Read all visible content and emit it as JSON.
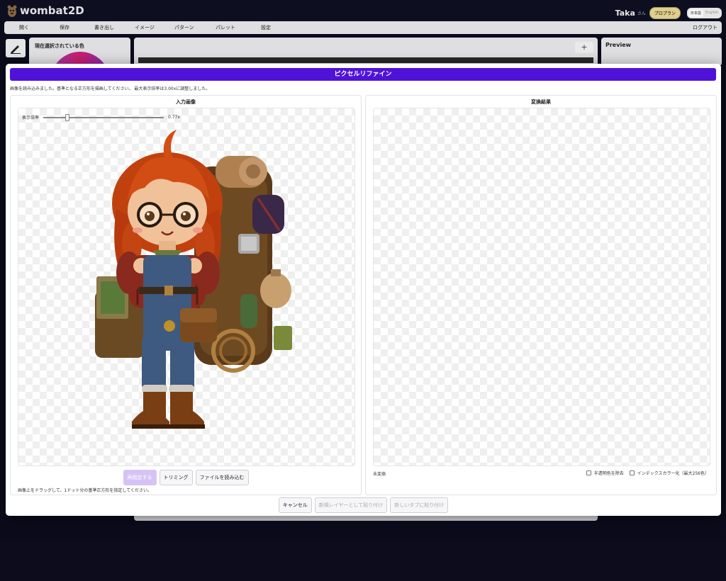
{
  "app": {
    "name": "wombat2D",
    "user_name": "Taka",
    "user_suffix": "さん",
    "plan_badge": "プロプラン",
    "languages": [
      "日本語",
      "English"
    ],
    "active_language": "日本語"
  },
  "menu": {
    "items": [
      "開く",
      "保存",
      "書き出し",
      "イメージ",
      "パターン",
      "パレット",
      "設定"
    ],
    "logout": "ログアウト"
  },
  "panels": {
    "selected_color_title": "現在選択されている色",
    "canvas_add": "+",
    "preview_title": "Preview"
  },
  "modal": {
    "title": "ピクセルリファイン",
    "status": "画像を読み込みました。基準となる正方形を描画してください。 最大表示倍率は3.00xに調整しました。",
    "input_pane": {
      "title": "入力画像",
      "zoom_label": "表示倍率",
      "zoom_value": "0.77x",
      "zoom_fraction": 0.2,
      "buttons": [
        "再指定する",
        "トリミング",
        "ファイルを読み込む"
      ],
      "hint": "画像上をドラッグして、1ドット分の基準正方形を指定してください。"
    },
    "output_pane": {
      "title": "変換結果",
      "status": "未変換",
      "options": [
        {
          "label": "半透明色を除去",
          "checked": false
        },
        {
          "label": "インデックスカラー化（最大256色）",
          "checked": false
        }
      ]
    },
    "footer": {
      "cancel": "キャンセル",
      "paste_new_layer": "新規レイヤーとして貼り付け",
      "paste_new_tab": "新しいタブに貼り付け"
    }
  },
  "colors": {
    "accent": "#5012d8",
    "background": "#0c0c1e"
  }
}
